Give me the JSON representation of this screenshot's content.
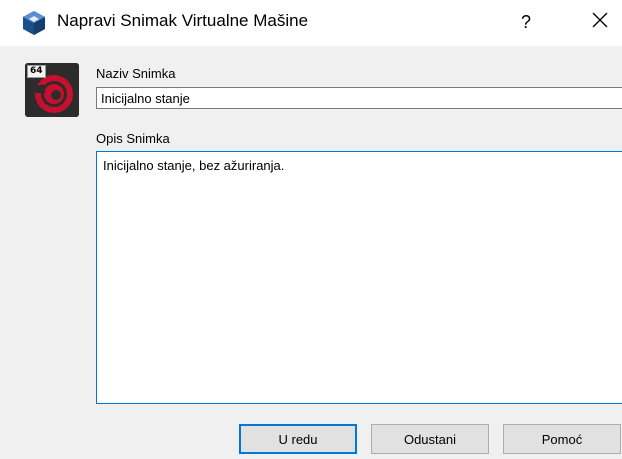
{
  "window": {
    "title": "Napravi Snimak Virtualne Mašine",
    "help_label": "?",
    "close_icon": "close-icon",
    "app_icon": "virtualbox-icon"
  },
  "os_badge": {
    "bits": "64",
    "icon": "debian-swirl-icon"
  },
  "form": {
    "name_label": "Naziv Snimka",
    "name_value": "Inicijalno stanje",
    "description_label": "Opis Snimka",
    "description_value": "Inicijalno stanje, bez ažuriranja."
  },
  "buttons": {
    "ok": "U redu",
    "cancel": "Odustani",
    "help": "Pomoć"
  },
  "colors": {
    "focus_accent": "#0078d7",
    "dialog_bg": "#f0f0f0",
    "os_badge_red": "#c8102e"
  }
}
